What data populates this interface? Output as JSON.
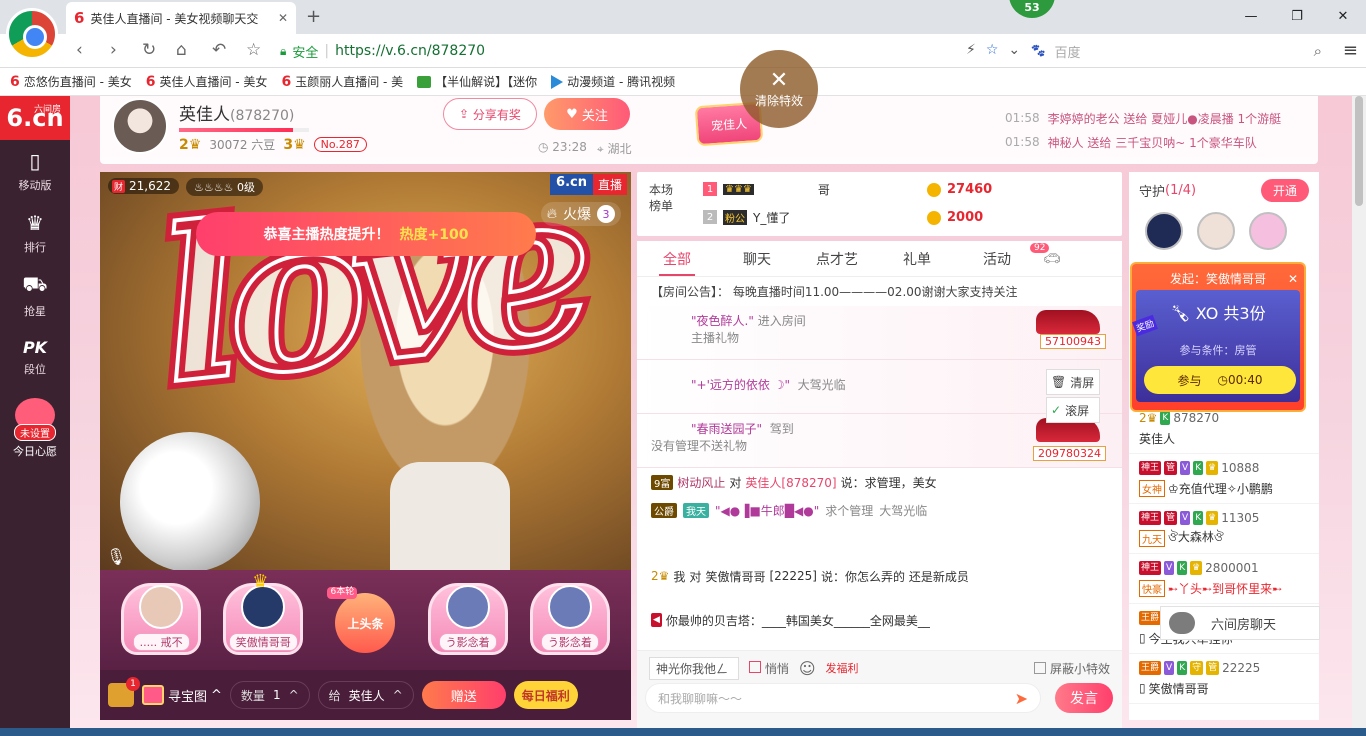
{
  "browser": {
    "tab_title": "英佳人直播间 - 美女视频聊天交",
    "url": "https://v.6.cn/878270",
    "safe_label": "安全",
    "search_placeholder": "百度",
    "notify_count": "53"
  },
  "bookmarks": [
    {
      "label": "恋悠伤直播间 - 美女",
      "icon": "6cn-icon"
    },
    {
      "label": "英佳人直播间 - 美女",
      "icon": "6cn-icon"
    },
    {
      "label": "玉颜丽人直播间 - 美",
      "icon": "6cn-icon"
    },
    {
      "label": "【半仙解说】【迷你",
      "icon": "green-icon"
    },
    {
      "label": "动漫频道 - 腾讯视频",
      "icon": "play-icon"
    }
  ],
  "leftnav": {
    "logo": "6.cn",
    "logo_sub": "六间房",
    "items": [
      {
        "label": "移动版",
        "icon": "phone-icon"
      },
      {
        "label": "排行",
        "icon": "crown-icon"
      },
      {
        "label": "抢星",
        "icon": "bag-icon"
      },
      {
        "label": "段位",
        "icon": "pk-icon",
        "glyph": "PK"
      }
    ],
    "wish_tag": "未设置",
    "wish_label": "今日心愿"
  },
  "room": {
    "host_name": "英佳人",
    "room_id": "(878270)",
    "level": "2",
    "fans": "30072 六豆",
    "level2": "3",
    "rank": "No.287",
    "share_label": "分享有奖",
    "follow_label": "关注",
    "time": "23:28",
    "location": "湖北",
    "pet_label": "宠佳人",
    "feeds": [
      {
        "time": "01:58",
        "text": "李婷婷的老公 送给 夏娅儿●凌晨播 1个游艇"
      },
      {
        "time": "01:58",
        "text": "神秘人 送给 三千宝贝呐~ 1个豪华车队"
      }
    ]
  },
  "video": {
    "coins": "21,622",
    "coins_tag": "财",
    "level_badge": "0级",
    "logo": "6.cn",
    "live_tag": "直播",
    "fire_label": "火爆",
    "fire_num": "3",
    "congrats": "恭喜主播热度提升！",
    "congrats_hot": "热度+100",
    "effect_text": "love"
  },
  "seats": [
    {
      "name": "..... 戒不"
    },
    {
      "name": "笑傲情哥哥"
    },
    {
      "name": "上头条",
      "tag": "6本轮"
    },
    {
      "name": "う影念着"
    },
    {
      "name": "う影念着"
    }
  ],
  "giftbar": {
    "bag_count": "1",
    "treasure_label": "寻宝图",
    "qty_label": "数量",
    "qty_value": "1",
    "to_label": "给",
    "to_value": "英佳人",
    "send_label": "赠送",
    "daily_label": "每日福利"
  },
  "rank": {
    "label_line1": "本场",
    "label_line2": "榜单",
    "rows": [
      {
        "pos": "1",
        "name": "哥",
        "score": "27460"
      },
      {
        "pos": "2",
        "name": "Y_懂了",
        "score": "2000"
      }
    ],
    "clear_fx": "清除特效"
  },
  "chat": {
    "tabs": [
      "全部",
      "聊天",
      "点才艺",
      "礼单",
      "活动"
    ],
    "car_badge": "92",
    "announce": "【房间公告】： 每晚直播时间11.00————02.00谢谢大家支持关注",
    "messages": [
      {
        "user": "\"夜色醉人.\"",
        "action": "进入房间",
        "sub": "主播礼物",
        "number": "57100943"
      },
      {
        "user": "\"+'远方的依依 ☽\"",
        "action": "大驾光临",
        "sub": "",
        "number": ""
      },
      {
        "user": "\"春雨送园子\"",
        "action": "驾到",
        "sub": "没有管理不送礼物",
        "number": "209780324"
      }
    ],
    "line1_user": "树动风止",
    "line1_to": "对",
    "line1_target": "英佳人[878270]",
    "line1_text": "说：求管理，美女",
    "line2_badge": "我天",
    "line2_user": "\"◀●▐■牛郎█◀●\"",
    "line2_mid": "求个管理",
    "line2_action": "大驾光临",
    "tool_clear": "清屏",
    "tool_scroll": "滚屏"
  },
  "chat_lower": {
    "row1_user": "我",
    "row1_to": "对",
    "row1_target": "笑傲情哥哥",
    "row1_id": "[22225]",
    "row1_text": "说：你怎么弄的 还是新成员",
    "row2_text": "你最帅的贝吉塔：____韩国美女______全网最美__"
  },
  "chat_input": {
    "target": "神光你我他ㄥ",
    "whisper": "悄悄",
    "welfare": "发福利",
    "block_fx": "屏蔽小特效",
    "placeholder": "和我聊聊嘛～～",
    "send": "发言"
  },
  "guard": {
    "title": "守护",
    "count": "(1/4)",
    "open_label": "开通",
    "list": [
      {
        "top": "878270",
        "bottom": "英佳人"
      },
      {
        "top": "10888",
        "tag": "女神",
        "bottom": "♔充值代理✧小鹏鹏"
      },
      {
        "top": "11305",
        "tag": "九天",
        "bottom": "ঔ大森林ঔ"
      },
      {
        "top": "2800001",
        "tag": "快豪",
        "bottom": "➸丫头➸到哥怀里来➸"
      },
      {
        "top": "",
        "tag": "",
        "bottom": "今生我只牵挂你"
      },
      {
        "top": "22225",
        "tag": "",
        "bottom": "笑傲情哥哥"
      }
    ]
  },
  "xo": {
    "title": "发起：笑傲情哥哥",
    "prize": "XO 共3份",
    "condition": "参与条件：房管",
    "join": "参与",
    "timer": "00:40",
    "corner_tag": "奖励"
  },
  "ad": {
    "label": "六间房聊天"
  }
}
